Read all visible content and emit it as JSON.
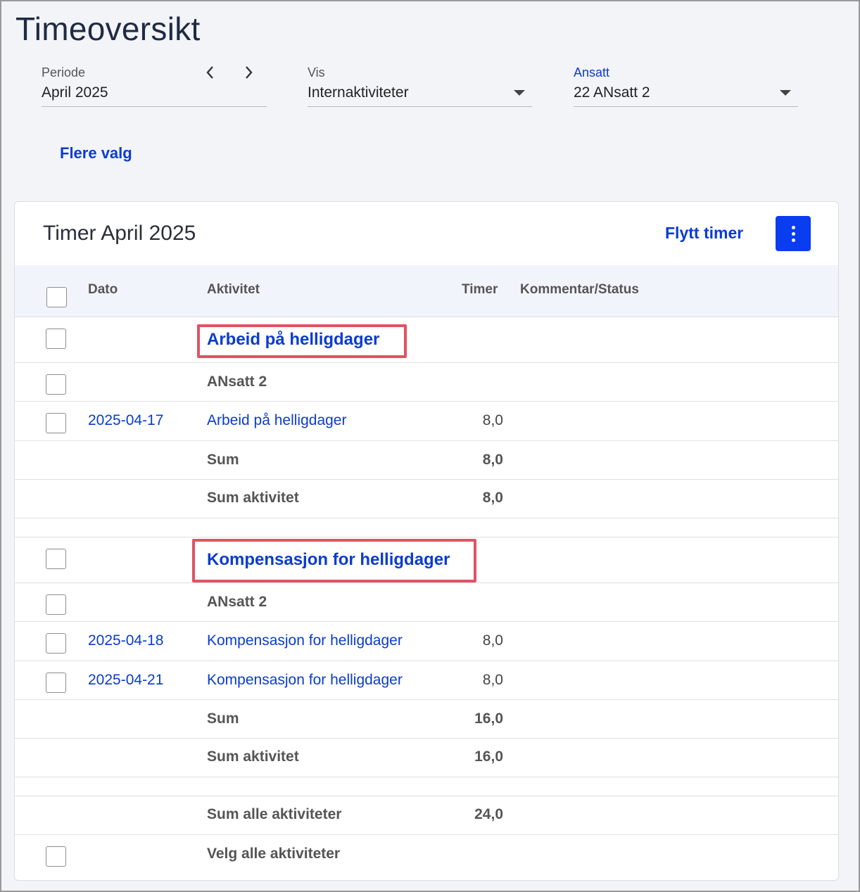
{
  "page": {
    "title": "Timeoversikt"
  },
  "filters": {
    "period": {
      "label": "Periode",
      "value": "April 2025"
    },
    "view": {
      "label": "Vis",
      "value": "Internaktiviteter"
    },
    "employee": {
      "label": "Ansatt",
      "value": "22 ANsatt 2"
    },
    "more_options": "Flere valg"
  },
  "card": {
    "title": "Timer April 2025",
    "move_hours": "Flytt timer",
    "columns": {
      "date": "Dato",
      "activity": "Aktivitet",
      "hours": "Timer",
      "comment": "Kommentar/Status"
    }
  },
  "groups": [
    {
      "title": "Arbeid på helligdager",
      "employee": "ANsatt 2",
      "entries": [
        {
          "date": "2025-04-17",
          "activity": "Arbeid på helligdager",
          "hours": "8,0"
        }
      ],
      "sum_label": "Sum",
      "sum": "8,0",
      "sum_activity_label": "Sum aktivitet",
      "sum_activity": "8,0"
    },
    {
      "title": "Kompensasjon for helligdager",
      "employee": "ANsatt 2",
      "entries": [
        {
          "date": "2025-04-18",
          "activity": "Kompensasjon for helligdager",
          "hours": "8,0"
        },
        {
          "date": "2025-04-21",
          "activity": "Kompensasjon for helligdager",
          "hours": "8,0"
        }
      ],
      "sum_label": "Sum",
      "sum": "16,0",
      "sum_activity_label": "Sum aktivitet",
      "sum_activity": "16,0"
    }
  ],
  "totals": {
    "all_label": "Sum alle aktiviteter",
    "all": "24,0",
    "select_all": "Velg alle aktiviteter"
  },
  "colors": {
    "accent": "#0a3ccf",
    "highlight": "#e05363",
    "button": "#0a3cf0"
  }
}
